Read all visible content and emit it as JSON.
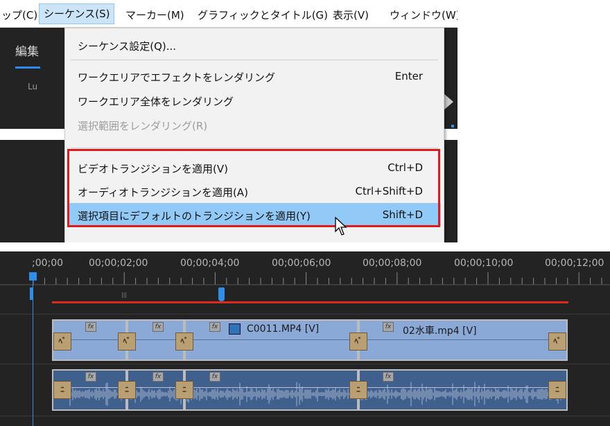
{
  "menubar": {
    "items": [
      "ップ(C)",
      "シーケンス(S)",
      "マーカー(M)",
      "グラフィックとタイトル(G)",
      "表示(V)",
      "ウィンドウ(W)"
    ],
    "active_index": 1
  },
  "background": {
    "tab_label": "編集",
    "lu_label": "Lu"
  },
  "dropdown": {
    "items": [
      {
        "label": "シーケンス設定(Q)...",
        "shortcut": "",
        "disabled": false
      },
      {
        "label": "ワークエリアでエフェクトをレンダリング",
        "shortcut": "Enter",
        "disabled": false
      },
      {
        "label": "ワークエリア全体をレンダリング",
        "shortcut": "",
        "disabled": false
      },
      {
        "label": "選択範囲をレンダリング(R)",
        "shortcut": "",
        "disabled": true
      },
      {
        "label": "ビデオトランジションを適用(V)",
        "shortcut": "Ctrl+D",
        "disabled": false
      },
      {
        "label": "オーディオトランジションを適用(A)",
        "shortcut": "Ctrl+Shift+D",
        "disabled": false
      },
      {
        "label": "選択項目にデフォルトのトランジションを適用(Y)",
        "shortcut": "Shift+D",
        "disabled": false,
        "highlighted": true
      }
    ]
  },
  "timeline": {
    "timecodes": [
      ";00;00",
      "00;00;02;00",
      "00;00;04;00",
      "00;00;06;00",
      "00;00;08;00",
      "00;00;10;00",
      "00;00;12;00"
    ],
    "video_clips": [
      {
        "name": ""
      },
      {
        "name": ""
      },
      {
        "name": "C0011.MP4 [V]"
      },
      {
        "name": "02水車.mp4 [V]"
      }
    ],
    "fx_label": "fx",
    "transition_video_label": "ﾍﾞ",
    "transition_audio_label": "ﾆ",
    "colors": {
      "video_clip": "#8aa9d6",
      "audio_clip": "#3f5f8c",
      "render_bar": "#dd2a1a",
      "playhead": "#2f8fe8",
      "transition": "#b99f72"
    }
  }
}
